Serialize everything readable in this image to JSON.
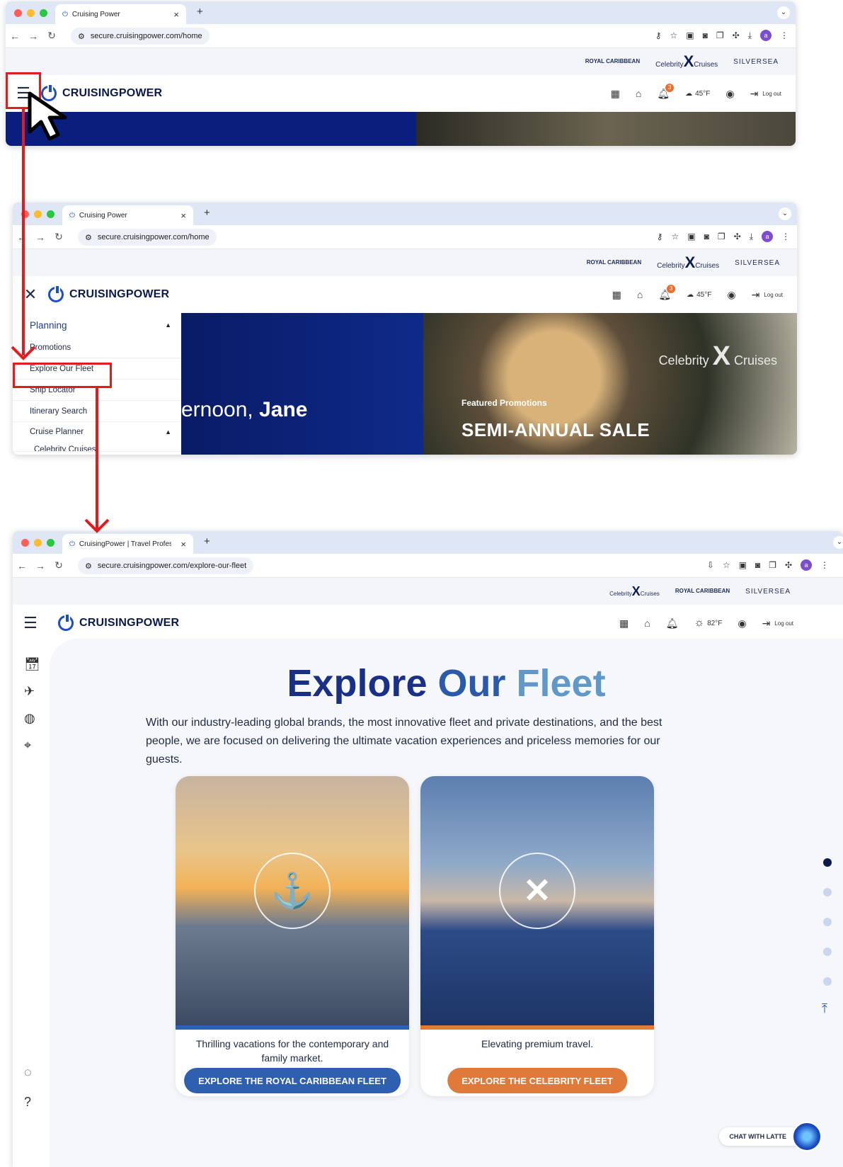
{
  "browser": {
    "tab_title_home": "Cruising Power",
    "tab_title_fleet": "CruisingPower | Travel Profes",
    "url_home": "secure.cruisingpower.com/home",
    "url_fleet": "secure.cruisingpower.com/explore-our-fleet",
    "profile_initial": "a"
  },
  "brands": {
    "royal": "ROYAL CARIBBEAN",
    "celebrity": "Celebrity",
    "celebrity_x": "X",
    "cruises": "Cruises",
    "silversea": "SILVERSEA"
  },
  "header": {
    "logo_text": "CRUISINGPOWER",
    "notification_count": "3",
    "temp_home": "45°F",
    "temp_fleet": "82°F",
    "logout": "Log out"
  },
  "hero": {
    "greeting_partial": "ernoon, ",
    "greeting_name": "Jane",
    "featured_label": "Featured Promotions",
    "sale_title": "SEMI-ANNUAL SALE",
    "celebrity_brand": "Celebrity",
    "celebrity_x": "X",
    "celebrity_cruises": "Cruises"
  },
  "menu": {
    "planning": "Planning",
    "promotions": "Promotions",
    "explore_fleet": "Explore Our Fleet",
    "ship_locator": "Ship Locator",
    "itinerary_search": "Itinerary Search",
    "cruise_planner": "Cruise Planner",
    "celebrity_cruises": "Celebrity Cruises"
  },
  "fleet_page": {
    "title_1": "Explore",
    "title_2": "Our",
    "title_3": "Fleet",
    "intro": "With our industry-leading global brands, the most innovative fleet and private destinations, and the best people, we are focused on delivering the ultimate vacation experiences and priceless memories for our guests.",
    "royal_desc": "Thrilling vacations for the contemporary and family market.",
    "royal_btn": "EXPLORE THE ROYAL CARIBBEAN FLEET",
    "celebrity_desc": "Elevating premium travel.",
    "celebrity_btn": "EXPLORE THE CELEBRITY FLEET",
    "chat_label": "CHAT WITH LATTE"
  },
  "colors": {
    "royal_blue": "#2f5fb0",
    "celebrity_orange": "#e07a3a",
    "highlight_red": "#e41b1b"
  }
}
